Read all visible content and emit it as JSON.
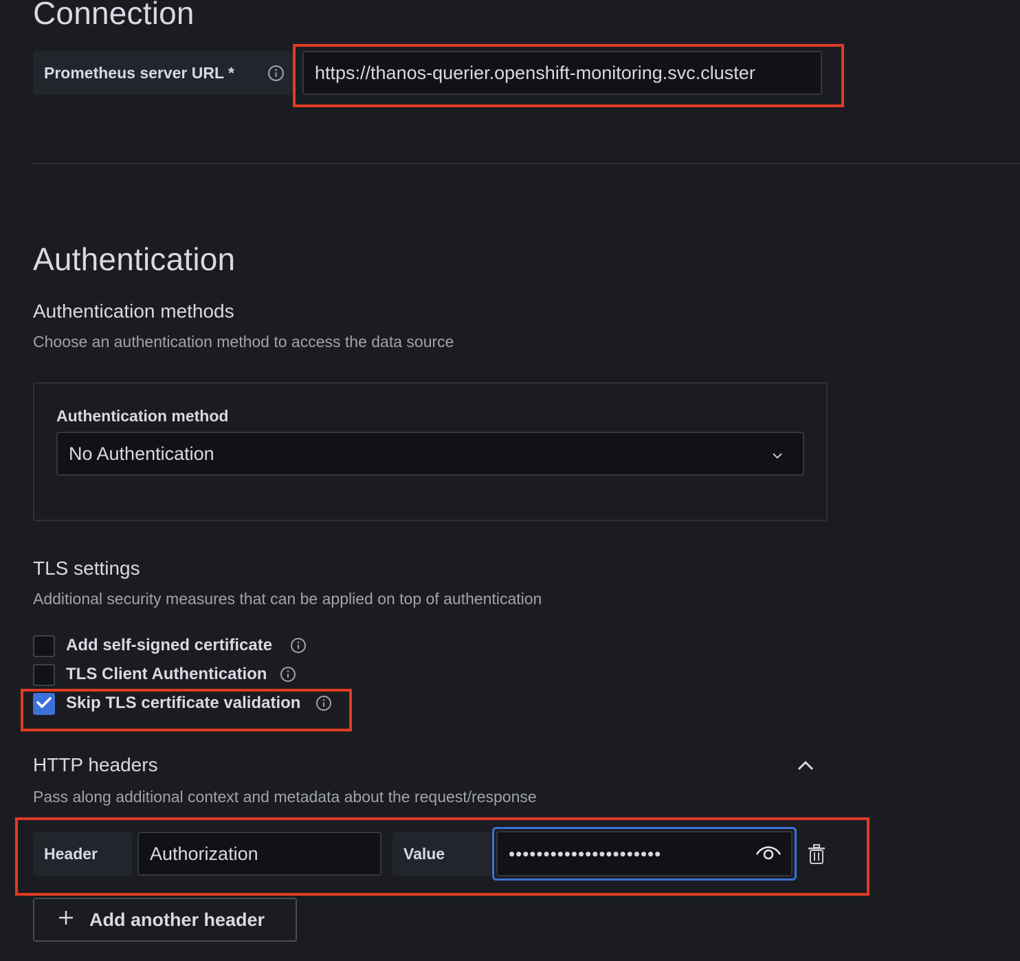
{
  "connection": {
    "title": "Connection",
    "url_label": "Prometheus server URL *",
    "url_value": "https://thanos-querier.openshift-monitoring.svc.cluster"
  },
  "authentication": {
    "title": "Authentication",
    "methods_title": "Authentication methods",
    "methods_desc": "Choose an authentication method to access the data source",
    "method_label": "Authentication method",
    "method_value": "No Authentication"
  },
  "tls": {
    "title": "TLS settings",
    "desc": "Additional security measures that can be applied on top of authentication",
    "options": [
      {
        "label": "Add self-signed certificate",
        "checked": false
      },
      {
        "label": "TLS Client Authentication",
        "checked": false
      },
      {
        "label": "Skip TLS certificate validation",
        "checked": true
      }
    ]
  },
  "http_headers": {
    "title": "HTTP headers",
    "desc": "Pass along additional context and metadata about the request/response",
    "header_label": "Header",
    "header_value": "Authorization",
    "value_label": "Value",
    "value_masked": "••••••••••••••••••••••",
    "add_button": "Add another header"
  },
  "colors": {
    "background": "#1b1c21",
    "highlight": "#e03b24",
    "focus": "#3d71d9",
    "checkbox_checked": "#3d71d9"
  }
}
